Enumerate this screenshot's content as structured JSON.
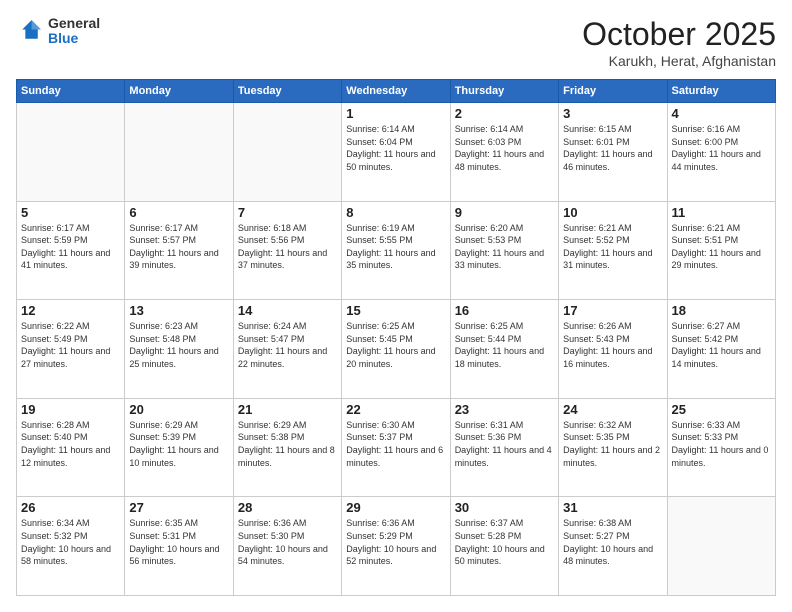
{
  "header": {
    "logo_general": "General",
    "logo_blue": "Blue",
    "month_title": "October 2025",
    "location": "Karukh, Herat, Afghanistan"
  },
  "days_of_week": [
    "Sunday",
    "Monday",
    "Tuesday",
    "Wednesday",
    "Thursday",
    "Friday",
    "Saturday"
  ],
  "weeks": [
    [
      {
        "day": "",
        "info": ""
      },
      {
        "day": "",
        "info": ""
      },
      {
        "day": "",
        "info": ""
      },
      {
        "day": "1",
        "info": "Sunrise: 6:14 AM\nSunset: 6:04 PM\nDaylight: 11 hours\nand 50 minutes."
      },
      {
        "day": "2",
        "info": "Sunrise: 6:14 AM\nSunset: 6:03 PM\nDaylight: 11 hours\nand 48 minutes."
      },
      {
        "day": "3",
        "info": "Sunrise: 6:15 AM\nSunset: 6:01 PM\nDaylight: 11 hours\nand 46 minutes."
      },
      {
        "day": "4",
        "info": "Sunrise: 6:16 AM\nSunset: 6:00 PM\nDaylight: 11 hours\nand 44 minutes."
      }
    ],
    [
      {
        "day": "5",
        "info": "Sunrise: 6:17 AM\nSunset: 5:59 PM\nDaylight: 11 hours\nand 41 minutes."
      },
      {
        "day": "6",
        "info": "Sunrise: 6:17 AM\nSunset: 5:57 PM\nDaylight: 11 hours\nand 39 minutes."
      },
      {
        "day": "7",
        "info": "Sunrise: 6:18 AM\nSunset: 5:56 PM\nDaylight: 11 hours\nand 37 minutes."
      },
      {
        "day": "8",
        "info": "Sunrise: 6:19 AM\nSunset: 5:55 PM\nDaylight: 11 hours\nand 35 minutes."
      },
      {
        "day": "9",
        "info": "Sunrise: 6:20 AM\nSunset: 5:53 PM\nDaylight: 11 hours\nand 33 minutes."
      },
      {
        "day": "10",
        "info": "Sunrise: 6:21 AM\nSunset: 5:52 PM\nDaylight: 11 hours\nand 31 minutes."
      },
      {
        "day": "11",
        "info": "Sunrise: 6:21 AM\nSunset: 5:51 PM\nDaylight: 11 hours\nand 29 minutes."
      }
    ],
    [
      {
        "day": "12",
        "info": "Sunrise: 6:22 AM\nSunset: 5:49 PM\nDaylight: 11 hours\nand 27 minutes."
      },
      {
        "day": "13",
        "info": "Sunrise: 6:23 AM\nSunset: 5:48 PM\nDaylight: 11 hours\nand 25 minutes."
      },
      {
        "day": "14",
        "info": "Sunrise: 6:24 AM\nSunset: 5:47 PM\nDaylight: 11 hours\nand 22 minutes."
      },
      {
        "day": "15",
        "info": "Sunrise: 6:25 AM\nSunset: 5:45 PM\nDaylight: 11 hours\nand 20 minutes."
      },
      {
        "day": "16",
        "info": "Sunrise: 6:25 AM\nSunset: 5:44 PM\nDaylight: 11 hours\nand 18 minutes."
      },
      {
        "day": "17",
        "info": "Sunrise: 6:26 AM\nSunset: 5:43 PM\nDaylight: 11 hours\nand 16 minutes."
      },
      {
        "day": "18",
        "info": "Sunrise: 6:27 AM\nSunset: 5:42 PM\nDaylight: 11 hours\nand 14 minutes."
      }
    ],
    [
      {
        "day": "19",
        "info": "Sunrise: 6:28 AM\nSunset: 5:40 PM\nDaylight: 11 hours\nand 12 minutes."
      },
      {
        "day": "20",
        "info": "Sunrise: 6:29 AM\nSunset: 5:39 PM\nDaylight: 11 hours\nand 10 minutes."
      },
      {
        "day": "21",
        "info": "Sunrise: 6:29 AM\nSunset: 5:38 PM\nDaylight: 11 hours\nand 8 minutes."
      },
      {
        "day": "22",
        "info": "Sunrise: 6:30 AM\nSunset: 5:37 PM\nDaylight: 11 hours\nand 6 minutes."
      },
      {
        "day": "23",
        "info": "Sunrise: 6:31 AM\nSunset: 5:36 PM\nDaylight: 11 hours\nand 4 minutes."
      },
      {
        "day": "24",
        "info": "Sunrise: 6:32 AM\nSunset: 5:35 PM\nDaylight: 11 hours\nand 2 minutes."
      },
      {
        "day": "25",
        "info": "Sunrise: 6:33 AM\nSunset: 5:33 PM\nDaylight: 11 hours\nand 0 minutes."
      }
    ],
    [
      {
        "day": "26",
        "info": "Sunrise: 6:34 AM\nSunset: 5:32 PM\nDaylight: 10 hours\nand 58 minutes."
      },
      {
        "day": "27",
        "info": "Sunrise: 6:35 AM\nSunset: 5:31 PM\nDaylight: 10 hours\nand 56 minutes."
      },
      {
        "day": "28",
        "info": "Sunrise: 6:36 AM\nSunset: 5:30 PM\nDaylight: 10 hours\nand 54 minutes."
      },
      {
        "day": "29",
        "info": "Sunrise: 6:36 AM\nSunset: 5:29 PM\nDaylight: 10 hours\nand 52 minutes."
      },
      {
        "day": "30",
        "info": "Sunrise: 6:37 AM\nSunset: 5:28 PM\nDaylight: 10 hours\nand 50 minutes."
      },
      {
        "day": "31",
        "info": "Sunrise: 6:38 AM\nSunset: 5:27 PM\nDaylight: 10 hours\nand 48 minutes."
      },
      {
        "day": "",
        "info": ""
      }
    ]
  ]
}
